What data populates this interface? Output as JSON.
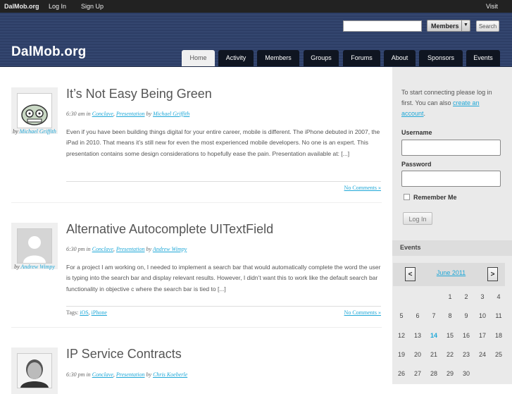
{
  "adminbar": {
    "site": "DalMob.org",
    "login": "Log In",
    "signup": "Sign Up",
    "visit": "Visit"
  },
  "header": {
    "title": "DalMob.org",
    "search_placeholder": "",
    "search_scope": "Members",
    "search_button": "Search"
  },
  "nav": {
    "tabs": [
      "Home",
      "Activity",
      "Members",
      "Groups",
      "Forums",
      "About",
      "Sponsors",
      "Events"
    ],
    "active": "Home"
  },
  "posts": [
    {
      "title": "It’s Not Easy Being Green",
      "time": "6:30 am",
      "in": "in",
      "categories": [
        "Conclave",
        "Presentation"
      ],
      "by": "by",
      "author": "Michael Griffith",
      "byline_by": "by",
      "byline_author": "Michael Griffith",
      "excerpt": "Even if you have been building things digital for your entire career, mobile is different. The iPhone debuted in 2007, the iPad in 2010. That means it’s still new for even the most experienced mobile developers. No one is an expert. This presentation contains some design considerations to hopefully ease the pain. Presentation available at: [...]",
      "tags_label": "",
      "tags": [],
      "comments": "No Comments »"
    },
    {
      "title": "Alternative Autocomplete UITextField",
      "time": "6:30 pm",
      "in": "in",
      "categories": [
        "Conclave",
        "Presentation"
      ],
      "by": "by",
      "author": "Andrew Wimpy",
      "byline_by": "by",
      "byline_author": "Andrew Wimpy",
      "excerpt": "For a project I am working on, I needed to implement a search bar that would automatically complete the word the user is typing into the search bar and display relevant results. However, I didn’t want this to work like the default search bar functionality in objective c where the search bar is tied to [...]",
      "tags_label": "Tags:",
      "tags": [
        "iOS",
        "iPhone"
      ],
      "comments": "No Comments »"
    },
    {
      "title": "IP Service Contracts",
      "time": "6:30 pm",
      "in": "in",
      "categories": [
        "Conclave",
        "Presentation"
      ],
      "by": "by",
      "author": "Chris Koeberle"
    }
  ],
  "sidebar": {
    "intro_text": "To start connecting please log in first. You can also ",
    "create_account": "create an account",
    "intro_end": ".",
    "username_label": "Username",
    "password_label": "Password",
    "remember_label": "Remember Me",
    "login_button": "Log In",
    "events_heading": "Events",
    "calendar": {
      "prev": "<",
      "next": ">",
      "month": "June 2011",
      "today": "14",
      "weeks": [
        [
          "",
          "",
          "",
          "1",
          "2",
          "3",
          "4"
        ],
        [
          "5",
          "6",
          "7",
          "8",
          "9",
          "10",
          "11"
        ],
        [
          "12",
          "13",
          "14",
          "15",
          "16",
          "17",
          "18"
        ],
        [
          "19",
          "20",
          "21",
          "22",
          "23",
          "24",
          "25"
        ],
        [
          "26",
          "27",
          "28",
          "29",
          "30",
          "",
          ""
        ]
      ]
    }
  },
  "colors": {
    "header_bg": "#2d3e66",
    "tab_bg": "#0f1521",
    "link": "#1fa8d8",
    "sidebar_bg": "#eaeaea"
  }
}
